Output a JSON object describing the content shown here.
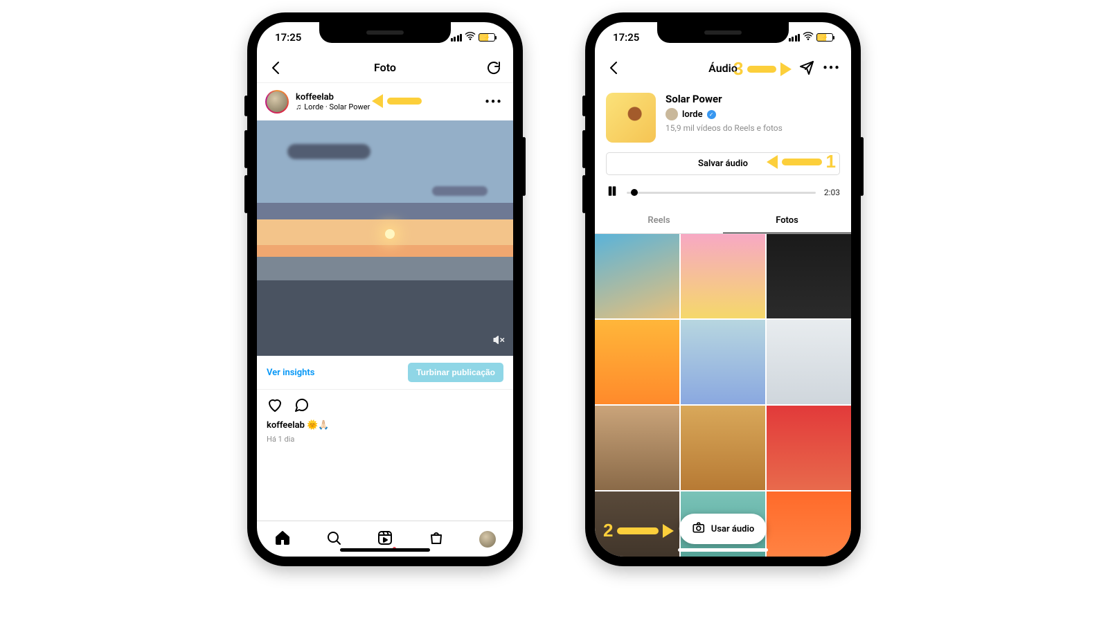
{
  "status": {
    "time": "17:25"
  },
  "left": {
    "nav_title": "Foto",
    "post": {
      "username": "koffeelab",
      "music": "Lorde · Solar Power",
      "insights_link": "Ver insights",
      "boost_btn": "Turbinar publicação",
      "caption_user": "koffeelab",
      "caption_emoji": "🌞🙏🏻",
      "timestamp": "Há 1 dia"
    }
  },
  "right": {
    "nav_title": "Áudio",
    "audio": {
      "title": "Solar Power",
      "artist": "lorde",
      "video_count": "15,9 mil vídeos do Reels e fotos",
      "save_btn": "Salvar áudio",
      "duration": "2:03",
      "tab_reels": "Reels",
      "tab_fotos": "Fotos",
      "use_audio": "Usar áudio"
    }
  },
  "annotations": {
    "n1": "1",
    "n2": "2",
    "n3": "3"
  },
  "grid_colors": [
    "linear-gradient(160deg,#5ab3d9,#e8c07a)",
    "linear-gradient(#f7a8c4,#f5d86a)",
    "linear-gradient(#1a1a1a,#2b2b2b)",
    "linear-gradient(#ffb63a,#ff8a2b)",
    "linear-gradient(#b7d6e0,#8aa8e0)",
    "linear-gradient(#e8ecef,#cfd6dc)",
    "linear-gradient(#caa47a,#8a6a48)",
    "linear-gradient(#d9a85a,#b77a34)",
    "linear-gradient(#e23a3a,#e86a4c)",
    "linear-gradient(#5a4a3a,#3a3026)",
    "linear-gradient(#7ac3b8,#4a9a8e)",
    "linear-gradient(#ff6a2a,#ff8a4a)"
  ]
}
